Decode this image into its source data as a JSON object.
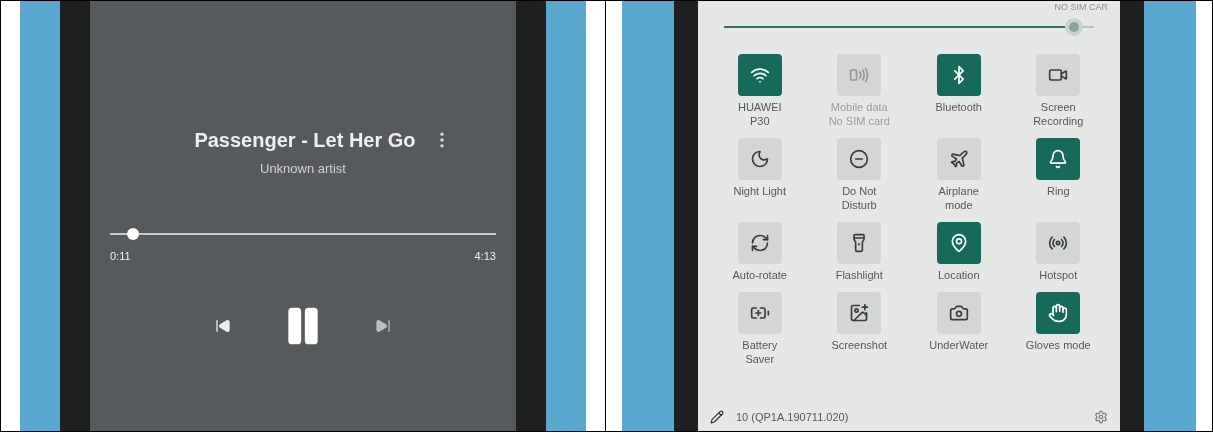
{
  "music_player": {
    "title": "Passenger - Let Her Go",
    "artist": "Unknown artist",
    "progress": {
      "level": 0.044,
      "elapsed": "0:11",
      "total": "4:13"
    }
  },
  "quick_settings": {
    "sim_status": "NO SIM CAR",
    "brightness": {
      "level": 0.97
    },
    "tiles": [
      {
        "label": "HUAWEI P30",
        "on": true,
        "disabled": false
      },
      {
        "label": "Mobile data",
        "sublabel": "No SIM card",
        "on": false,
        "disabled": true
      },
      {
        "label": "Bluetooth",
        "on": true,
        "disabled": false
      },
      {
        "label": "Screen Recording",
        "on": false,
        "disabled": false
      },
      {
        "label": "Night Light",
        "on": false,
        "disabled": false
      },
      {
        "label": "Do Not Disturb",
        "on": false,
        "disabled": false
      },
      {
        "label": "Airplane mode",
        "on": false,
        "disabled": false
      },
      {
        "label": "Ring",
        "on": true,
        "disabled": false
      },
      {
        "label": "Auto-rotate",
        "on": false,
        "disabled": false
      },
      {
        "label": "Flashlight",
        "on": false,
        "disabled": false
      },
      {
        "label": "Location",
        "on": true,
        "disabled": false
      },
      {
        "label": "Hotspot",
        "on": false,
        "disabled": false
      },
      {
        "label": "Battery Saver",
        "on": false,
        "disabled": false
      },
      {
        "label": "Screenshot",
        "on": false,
        "disabled": false
      },
      {
        "label": "UnderWater",
        "on": false,
        "disabled": false
      },
      {
        "label": "Gloves mode",
        "on": true,
        "disabled": false
      }
    ],
    "build": "10 (QP1A.190711.020)"
  }
}
